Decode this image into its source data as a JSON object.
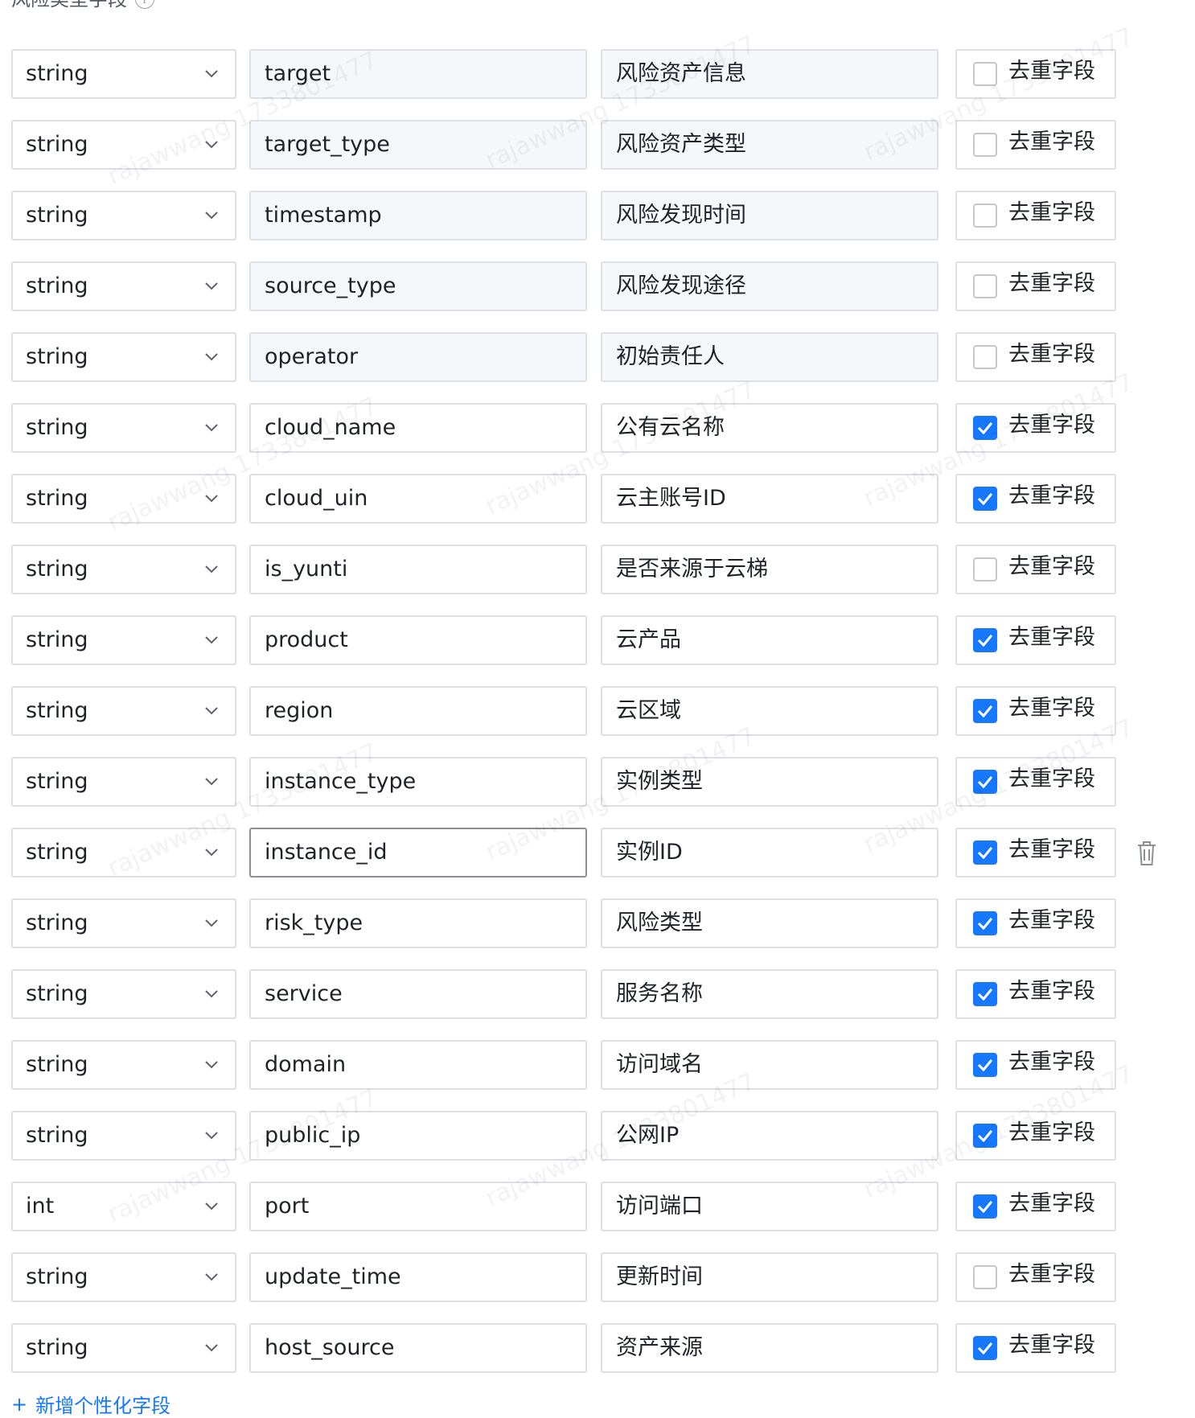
{
  "section": {
    "title": "风险类型字段",
    "info_icon": "info-icon"
  },
  "checkbox_label": "去重字段",
  "fields": [
    {
      "type": "string",
      "name": "target",
      "desc": "风险资产信息",
      "dedup": false,
      "disabled": true
    },
    {
      "type": "string",
      "name": "target_type",
      "desc": "风险资产类型",
      "dedup": false,
      "disabled": true
    },
    {
      "type": "string",
      "name": "timestamp",
      "desc": "风险发现时间",
      "dedup": false,
      "disabled": true
    },
    {
      "type": "string",
      "name": "source_type",
      "desc": "风险发现途径",
      "dedup": false,
      "disabled": true
    },
    {
      "type": "string",
      "name": "operator",
      "desc": "初始责任人",
      "dedup": false,
      "disabled": true
    },
    {
      "type": "string",
      "name": "cloud_name",
      "desc": "公有云名称",
      "dedup": true,
      "disabled": false
    },
    {
      "type": "string",
      "name": "cloud_uin",
      "desc": "云主账号ID",
      "dedup": true,
      "disabled": false
    },
    {
      "type": "string",
      "name": "is_yunti",
      "desc": "是否来源于云梯",
      "dedup": false,
      "disabled": false
    },
    {
      "type": "string",
      "name": "product",
      "desc": "云产品",
      "dedup": true,
      "disabled": false
    },
    {
      "type": "string",
      "name": "region",
      "desc": "云区域",
      "dedup": true,
      "disabled": false
    },
    {
      "type": "string",
      "name": "instance_type",
      "desc": "实例类型",
      "dedup": true,
      "disabled": false
    },
    {
      "type": "string",
      "name": "instance_id",
      "desc": "实例ID",
      "dedup": true,
      "disabled": false,
      "focused": true,
      "show_delete": true
    },
    {
      "type": "string",
      "name": "risk_type",
      "desc": "风险类型",
      "dedup": true,
      "disabled": false
    },
    {
      "type": "string",
      "name": "service",
      "desc": "服务名称",
      "dedup": true,
      "disabled": false
    },
    {
      "type": "string",
      "name": "domain",
      "desc": "访问域名",
      "dedup": true,
      "disabled": false
    },
    {
      "type": "string",
      "name": "public_ip",
      "desc": "公网IP",
      "dedup": true,
      "disabled": false
    },
    {
      "type": "int",
      "name": "port",
      "desc": "访问端口",
      "dedup": true,
      "disabled": false
    },
    {
      "type": "string",
      "name": "update_time",
      "desc": "更新时间",
      "dedup": false,
      "disabled": false
    },
    {
      "type": "string",
      "name": "host_source",
      "desc": "资产来源",
      "dedup": true,
      "disabled": false
    }
  ],
  "add_link": {
    "label": "新增个性化字段",
    "icon": "plus-icon"
  },
  "watermark": {
    "text": "rajawwang 1733801477"
  },
  "colors": {
    "accent": "#1677ff",
    "border": "#dcdfe6",
    "disabled_bg": "#f5f7fa"
  }
}
